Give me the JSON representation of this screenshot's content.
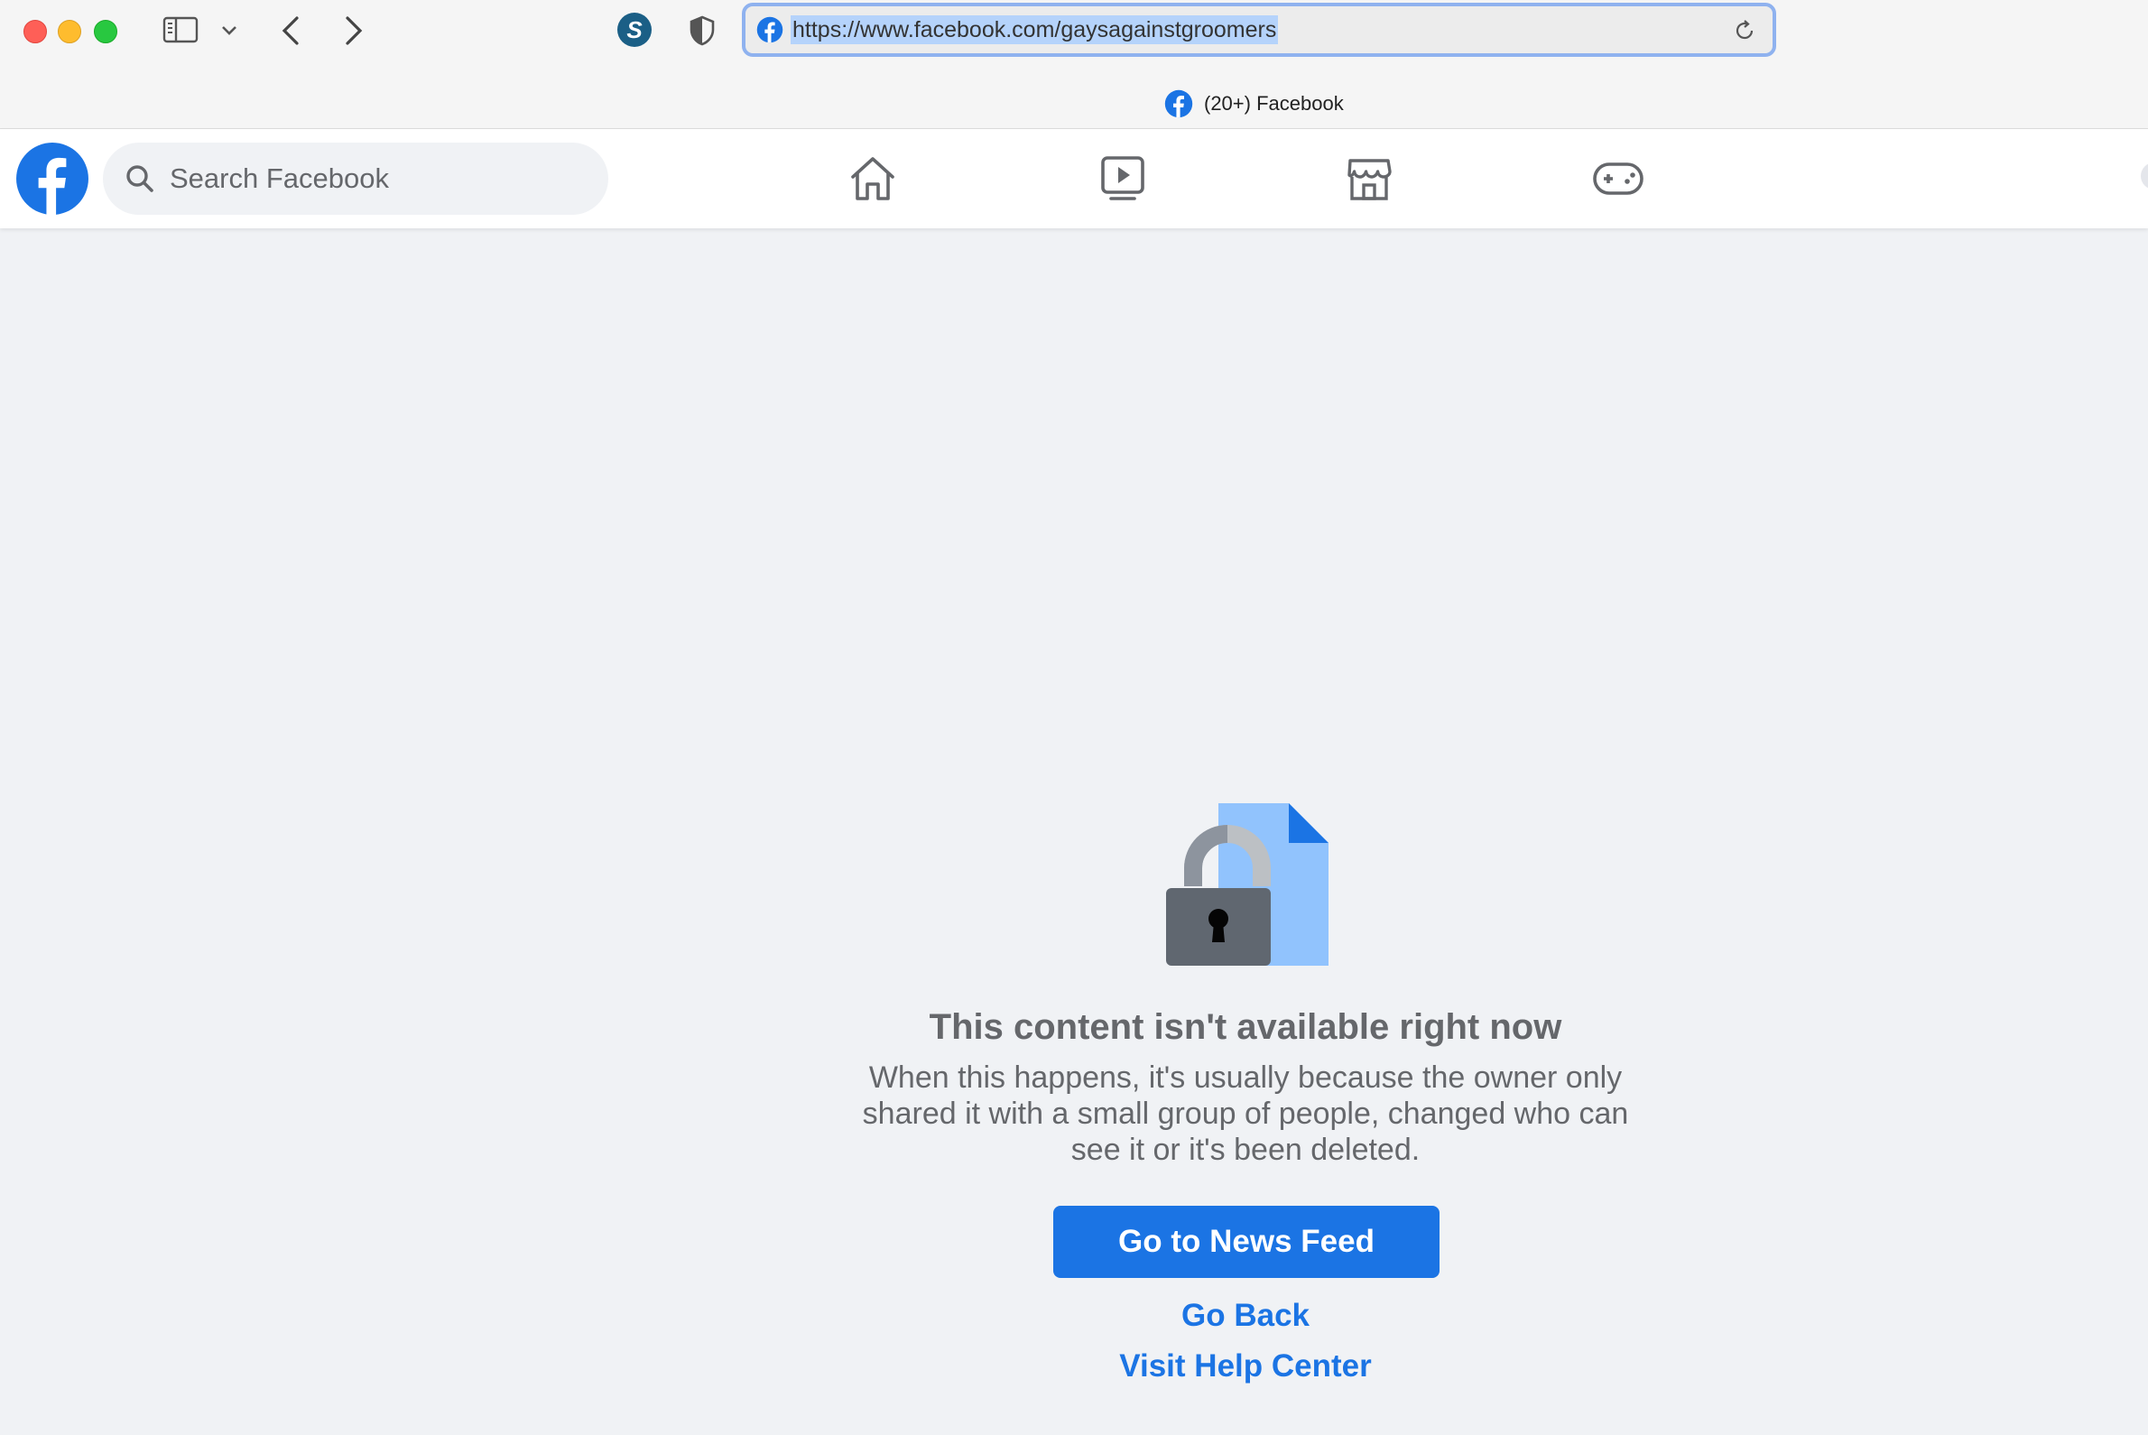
{
  "browser": {
    "url": "https://www.facebook.com/gaysagainstgroomers",
    "tab_title": "(20+) Facebook",
    "extension_letter": "S"
  },
  "facebook": {
    "search_placeholder": "Search Facebook",
    "nav": [
      "home-icon",
      "watch-icon",
      "marketplace-icon",
      "gaming-icon"
    ],
    "brand_color": "#1b74e4"
  },
  "error": {
    "title": "This content isn't available right now",
    "body": "When this happens, it's usually because the owner only shared it with a small group of people, changed who can see it or it's been deleted.",
    "primary_button": "Go to News Feed",
    "link_back": "Go Back",
    "link_help": "Visit Help Center"
  }
}
